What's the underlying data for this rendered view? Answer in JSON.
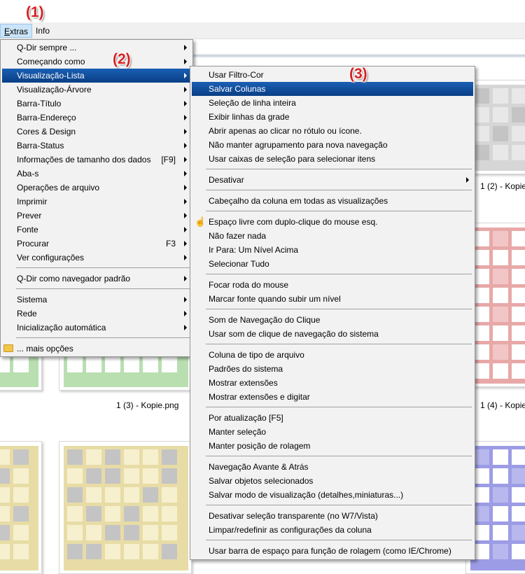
{
  "annotations": [
    "(1)",
    "(2)",
    "(3)"
  ],
  "menubar": {
    "extras": "Extras",
    "info": "Info"
  },
  "captions": [
    "1 (2) - Kopie",
    "1 (3) - Kopie.png",
    "1 (4) - Kopie"
  ],
  "main_menu": [
    {
      "label": "Q-Dir sempre ...",
      "sub": true
    },
    {
      "label": "Começando como",
      "sub": true
    },
    {
      "label": "Visualização-Lista",
      "sub": true,
      "highlight": true
    },
    {
      "label": "Visualização-Árvore",
      "sub": true
    },
    {
      "label": "Barra-Título",
      "sub": true
    },
    {
      "label": "Barra-Endereço",
      "sub": true
    },
    {
      "label": "Cores & Design",
      "sub": true
    },
    {
      "label": "Barra-Status",
      "sub": true
    },
    {
      "label": "Informações de tamanho dos dados",
      "shortcut": "[F9]",
      "sub": true
    },
    {
      "label": "Aba-s",
      "sub": true
    },
    {
      "label": "Operações de arquivo",
      "sub": true
    },
    {
      "label": "Imprimir",
      "sub": true
    },
    {
      "label": "Prever",
      "sub": true
    },
    {
      "label": "Fonte",
      "sub": true
    },
    {
      "label": "Procurar",
      "shortcut": "F3",
      "sub": true
    },
    {
      "label": "Ver configurações",
      "sub": true
    },
    {
      "sep": true
    },
    {
      "label": "Q-Dir como navegador padrão",
      "sub": true
    },
    {
      "sep": true
    },
    {
      "label": "Sistema",
      "sub": true
    },
    {
      "label": "Rede",
      "sub": true
    },
    {
      "label": "Inicialização automática",
      "sub": true
    },
    {
      "sep": true
    },
    {
      "label": "... mais opções",
      "icon": "folder-icon"
    }
  ],
  "sub_menu": [
    {
      "label": "Usar Filtro-Cor"
    },
    {
      "label": "Salvar Colunas",
      "highlight": true
    },
    {
      "label": "Seleção de linha inteira"
    },
    {
      "label": "Exibir linhas da grade"
    },
    {
      "label": "Abrir apenas ao clicar no rótulo ou ícone."
    },
    {
      "label": "Não manter agrupamento para nova navegação"
    },
    {
      "label": "Usar caixas de seleção para selecionar itens"
    },
    {
      "sep": true
    },
    {
      "label": "Desativar",
      "sub": true
    },
    {
      "sep": true
    },
    {
      "label": "Cabeçalho da coluna em todas as visualizações"
    },
    {
      "sep": true
    },
    {
      "label": "Espaço livre com duplo-clique do mouse esq.",
      "icon": "hand-icon"
    },
    {
      "label": "Não fazer nada"
    },
    {
      "label": "Ir Para: Um Nível Acima"
    },
    {
      "label": "Selecionar Tudo"
    },
    {
      "sep": true
    },
    {
      "label": "Focar roda do mouse"
    },
    {
      "label": "Marcar fonte quando subir um nível"
    },
    {
      "sep": true
    },
    {
      "label": "Som de Navegação do Clique"
    },
    {
      "label": "Usar som de clique de navegação do sistema"
    },
    {
      "sep": true
    },
    {
      "label": "Coluna de tipo de arquivo"
    },
    {
      "label": "Padrões do sistema"
    },
    {
      "label": "Mostrar extensões"
    },
    {
      "label": "Mostrar extensões e digitar"
    },
    {
      "sep": true
    },
    {
      "label": "Por atualização [F5]"
    },
    {
      "label": "Manter seleção"
    },
    {
      "label": "Manter posição de rolagem"
    },
    {
      "sep": true
    },
    {
      "label": "Navegação Avante & Atrás"
    },
    {
      "label": "Salvar objetos selecionados"
    },
    {
      "label": "Salvar modo de visualização (detalhes,miniaturas...)"
    },
    {
      "sep": true
    },
    {
      "label": "Desativar seleção transparente (no W7/Vista)"
    },
    {
      "label": "Limpar/redefinir as configurações da coluna"
    },
    {
      "sep": true
    },
    {
      "label": "Usar barra de espaço para função de rolagem (como IE/Chrome)"
    }
  ],
  "colors": {
    "highlight": "#0a4a9a",
    "annotation": "#d42020"
  }
}
